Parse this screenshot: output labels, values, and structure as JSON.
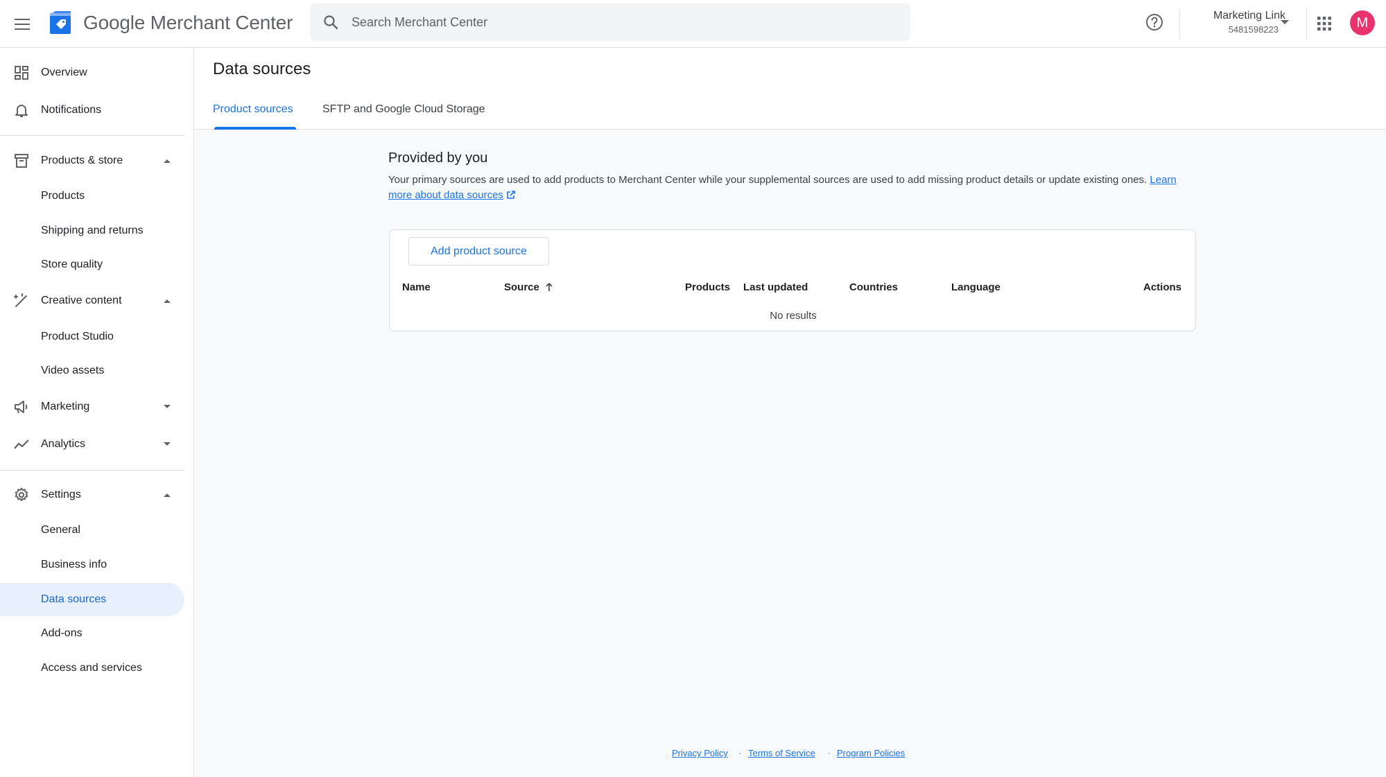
{
  "header": {
    "app_title": "Google Merchant Center",
    "search_placeholder": "Search Merchant Center",
    "account_name": "Marketing Link",
    "account_id": "5481598223",
    "avatar_letter": "M",
    "avatar_color": "#e8336f"
  },
  "sidebar": {
    "overview": "Overview",
    "notifications": "Notifications",
    "products_store": "Products & store",
    "products": "Products",
    "shipping": "Shipping and returns",
    "store_quality": "Store quality",
    "creative": "Creative content",
    "product_studio": "Product Studio",
    "video_assets": "Video assets",
    "marketing": "Marketing",
    "analytics": "Analytics",
    "settings": "Settings",
    "general": "General",
    "business_info": "Business info",
    "data_sources": "Data sources",
    "addons": "Add-ons",
    "access": "Access and services"
  },
  "main": {
    "page_title": "Data sources",
    "tabs": [
      "Product sources",
      "SFTP and Google Cloud Storage"
    ],
    "section_title": "Provided by you",
    "section_desc": "Your primary sources are used to add products to Merchant Center while your supplemental sources are used to add missing product details or update existing ones.",
    "learn_more": "Learn more about data sources",
    "add_button": "Add product source",
    "columns": {
      "name": "Name",
      "source": "Source",
      "products": "Products",
      "last_updated": "Last updated",
      "countries": "Countries",
      "language": "Language",
      "actions": "Actions"
    },
    "no_results": "No results"
  },
  "footer": {
    "privacy": "Privacy Policy",
    "terms": "Terms of Service",
    "program": "Program Policies",
    "separator": "·"
  },
  "colors": {
    "accent": "#1a73e8",
    "active_bg": "#e8f0fe"
  }
}
